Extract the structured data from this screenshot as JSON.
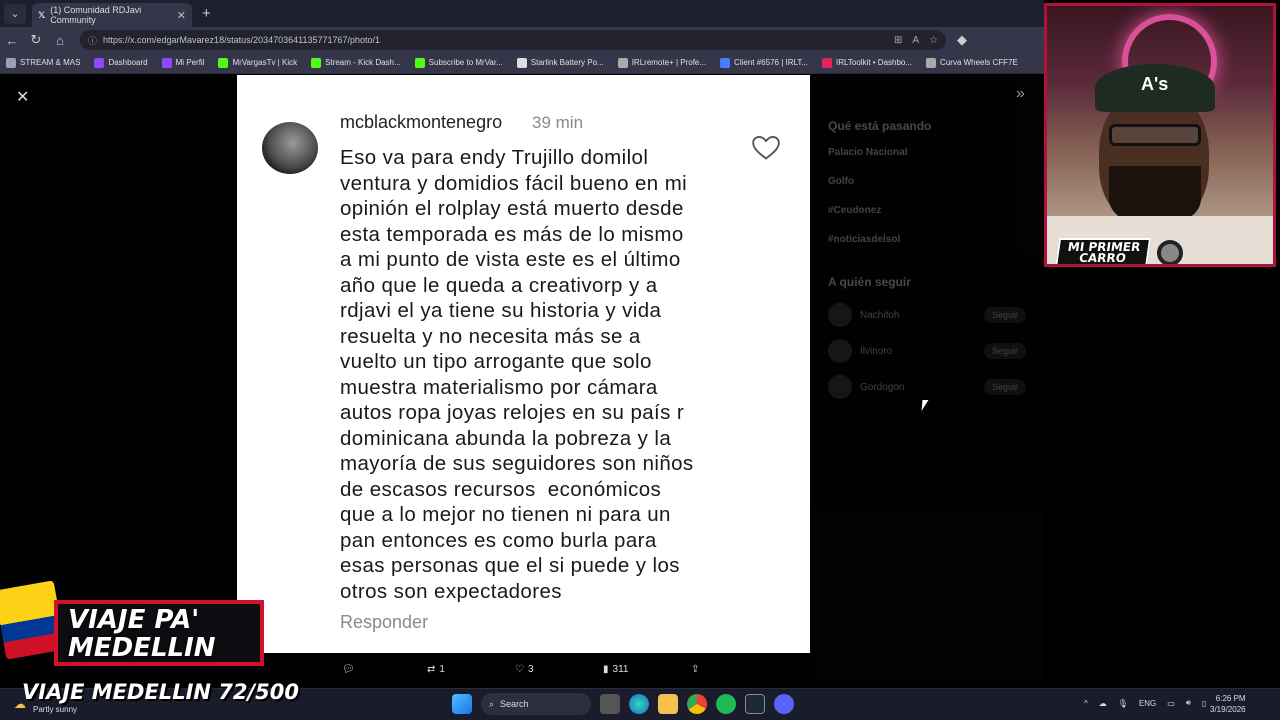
{
  "browser": {
    "tab_title": "(1) Comunidad RDJavi Community",
    "url": "https://x.com/edgarMavarez18/status/2034703641135771767/photo/1",
    "bookmarks": [
      {
        "label": "STREAM & MAS",
        "color": "#9aa0b5"
      },
      {
        "label": "Dashboard",
        "color": "#9146ff"
      },
      {
        "label": "Mi Perfil",
        "color": "#9146ff"
      },
      {
        "label": "MrVargasTv | Kick",
        "color": "#53fc18"
      },
      {
        "label": "Stream - Kick Dash...",
        "color": "#53fc18"
      },
      {
        "label": "Subscribe to MrVar...",
        "color": "#53fc18"
      },
      {
        "label": "Starlink Battery Po...",
        "color": "#dddddd"
      },
      {
        "label": "IRLremote+ | Profe...",
        "color": "#aaaaaa"
      },
      {
        "label": "Client #6576 | IRLT...",
        "color": "#4a7cff"
      },
      {
        "label": "IRLToolkit • Dashbo...",
        "color": "#e0245e"
      },
      {
        "label": "Curva Wheels CFF7E",
        "color": "#aaaaaa"
      }
    ]
  },
  "post": {
    "username": "mcblackmontenegro",
    "time": "39 min",
    "comment_lines": [
      "Eso va para endy Trujillo domilol",
      "ventura y domidios fácil bueno en mi",
      "opinión el rolplay está muerto desde",
      "esta temporada es más de lo mismo",
      "a mi punto de vista este es el último",
      "año que le queda a creativorp y a",
      "rdjavi el ya tiene su historia y vida",
      "resuelta y no necesita más se a",
      "vuelto un tipo arrogante que solo",
      "muestra materialismo por cámara",
      "autos ropa joyas relojes en su país r",
      "dominicana abunda la pobreza y la",
      "mayoría de sus seguidores son niños",
      "de escasos recursos  económicos",
      "que a lo mejor no tienen ni para un",
      "pan entonces es como burla para",
      "esas personas que el si puede y los",
      "otros son expectadores"
    ],
    "reply_label": "Responder"
  },
  "actions": {
    "reposts": "1",
    "likes": "3",
    "views": "311"
  },
  "sidebar": {
    "trends_title": "Qué está pasando",
    "trends": [
      "Palacio Nacional",
      "Golfo",
      "#Ceudonez",
      "#noticiasdelsol"
    ],
    "follow_title": "A quién seguir",
    "follow": [
      {
        "name": "Nachitoh",
        "button": "Seguir"
      },
      {
        "name": "Ilvinoro",
        "button": "Seguir"
      },
      {
        "name": "Gordogon",
        "button": "Seguir"
      }
    ]
  },
  "webcam": {
    "cap_logo": "A's",
    "label_line1": "MI PRIMER",
    "label_line2": "CARRO"
  },
  "stream_overlay": {
    "banner_line1": "VIAJE PA'",
    "banner_line2": "MEDELLIN",
    "counter": "VIAJE MEDELLIN 72/500"
  },
  "taskbar": {
    "weather": "Partly sunny",
    "search_label": "Search",
    "language": "ENG",
    "time": "6:26 PM",
    "date": "3/19/2026"
  },
  "colors": {
    "accent_red": "#d2112e",
    "tab_bg": "#35364a",
    "taskbar_bg": "#1a1c2c"
  }
}
